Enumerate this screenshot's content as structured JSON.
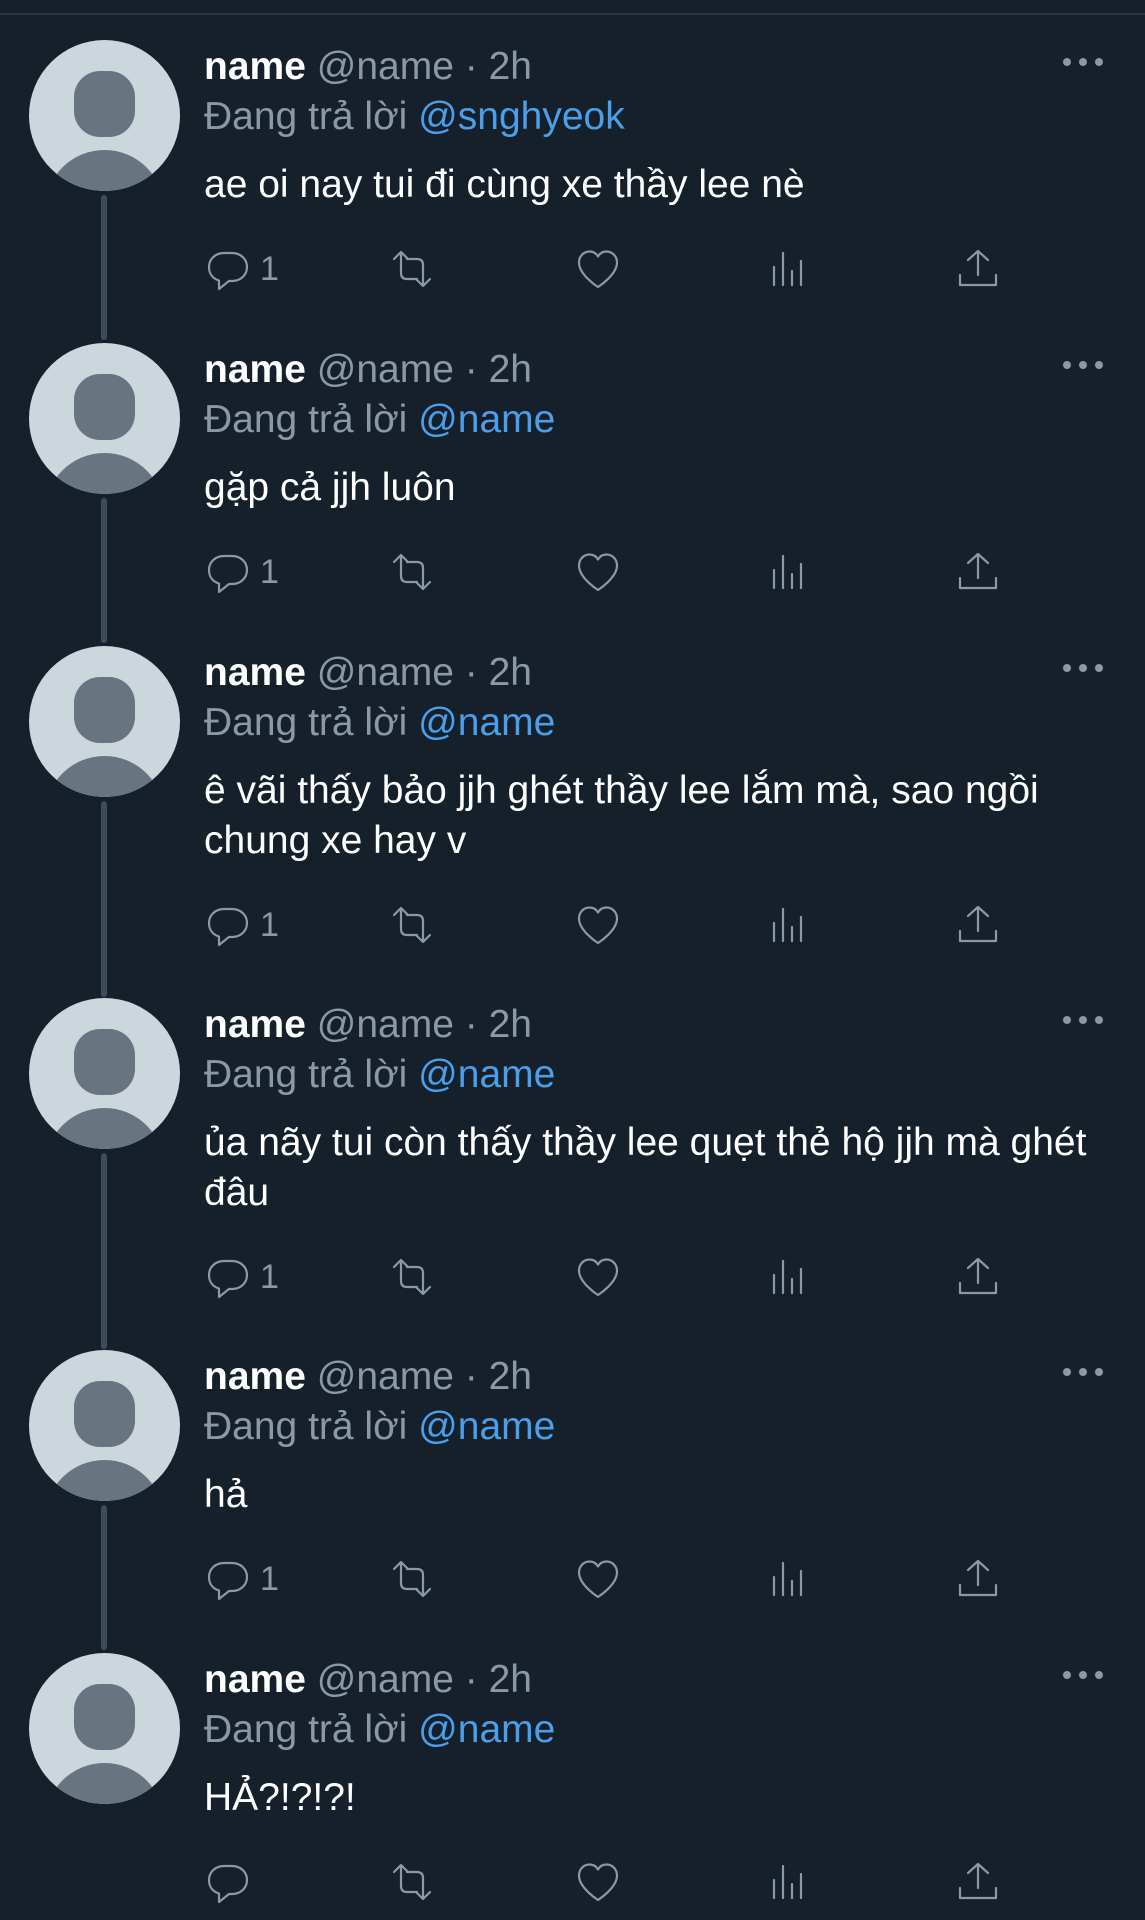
{
  "tweets": [
    {
      "display_name": "name",
      "handle": "@name",
      "separator": "·",
      "time": "2h",
      "replying_label": "Đang trả lời",
      "replying_to": "@snghyeok",
      "text": "ae oi nay tui đi cùng xe thầy lee nè",
      "reply_count": "1"
    },
    {
      "display_name": "name",
      "handle": "@name",
      "separator": "·",
      "time": "2h",
      "replying_label": "Đang trả lời",
      "replying_to": "@name",
      "text": "gặp cả jjh luôn",
      "reply_count": "1"
    },
    {
      "display_name": "name",
      "handle": "@name",
      "separator": "·",
      "time": "2h",
      "replying_label": "Đang trả lời",
      "replying_to": "@name",
      "text": "ê vãi thấy bảo jjh ghét thầy lee lắm mà, sao ngồi chung xe hay v",
      "reply_count": "1"
    },
    {
      "display_name": "name",
      "handle": "@name",
      "separator": "·",
      "time": "2h",
      "replying_label": "Đang trả lời",
      "replying_to": "@name",
      "text": "ủa nãy tui còn thấy thầy lee quẹt thẻ hộ jjh mà ghét đâu",
      "reply_count": "1"
    },
    {
      "display_name": "name",
      "handle": "@name",
      "separator": "·",
      "time": "2h",
      "replying_label": "Đang trả lời",
      "replying_to": "@name",
      "text": "hả",
      "reply_count": "1"
    },
    {
      "display_name": "name",
      "handle": "@name",
      "separator": "·",
      "time": "2h",
      "replying_label": "Đang trả lời",
      "replying_to": "@name",
      "text": "HẢ?!?!?!",
      "reply_count": ""
    }
  ],
  "icons": {
    "reply": "reply-icon",
    "retweet": "retweet-icon",
    "like": "heart-icon",
    "views": "views-icon",
    "share": "share-icon",
    "more": "more-icon"
  },
  "colors": {
    "background": "#15202b",
    "accent": "#4a9eea",
    "secondary_text": "#8b98a5"
  }
}
